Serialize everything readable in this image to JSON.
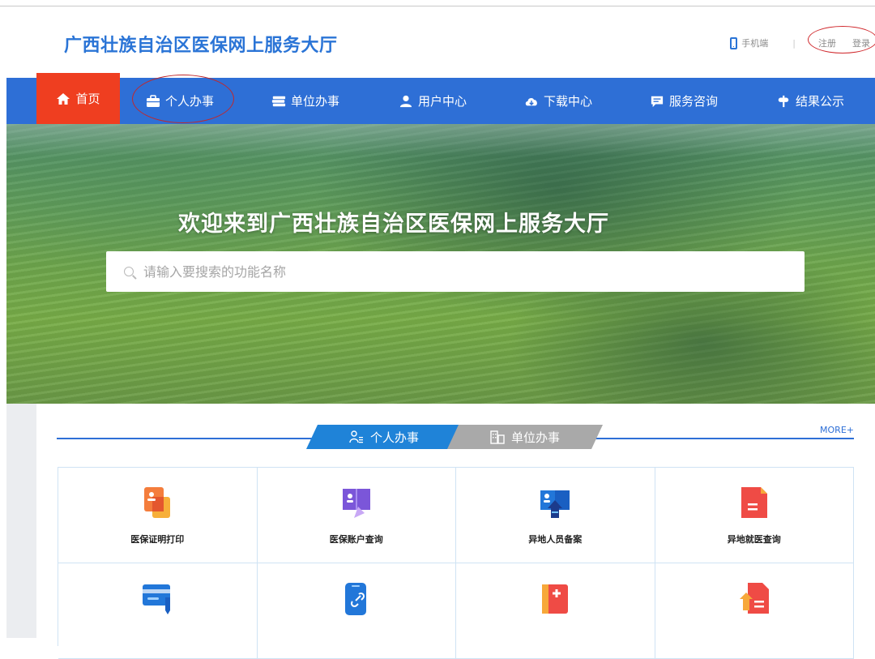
{
  "header": {
    "title": "广西壮族自治区医保网上服务大厅",
    "mobile_label": "手机端",
    "divider": "|",
    "register_label": "注册",
    "login_label": "登录"
  },
  "nav": {
    "items": [
      {
        "label": "首页",
        "icon": "home-icon"
      },
      {
        "label": "个人办事",
        "icon": "briefcase-icon"
      },
      {
        "label": "单位办事",
        "icon": "unit-icon"
      },
      {
        "label": "用户中心",
        "icon": "user-icon"
      },
      {
        "label": "下载中心",
        "icon": "cloud-download-icon"
      },
      {
        "label": "服务咨询",
        "icon": "chat-icon"
      },
      {
        "label": "结果公示",
        "icon": "signpost-icon"
      }
    ],
    "active_color": "#ef3e20",
    "bar_color": "#2e6fd6"
  },
  "hero": {
    "title": "欢迎来到广西壮族自治区医保网上服务大厅",
    "search_placeholder": "请输入要搜索的功能名称"
  },
  "services": {
    "tabs": [
      {
        "label": "个人办事",
        "active": true
      },
      {
        "label": "单位办事",
        "active": false
      }
    ],
    "more_label": "MORE+",
    "items": [
      {
        "label": "医保证明打印",
        "icon": "certificate-print-icon"
      },
      {
        "label": "医保账户查询",
        "icon": "account-query-icon"
      },
      {
        "label": "异地人员备案",
        "icon": "remote-registration-icon"
      },
      {
        "label": "异地就医查询",
        "icon": "remote-medical-query-icon"
      },
      {
        "label": "",
        "icon": "card-edit-icon"
      },
      {
        "label": "",
        "icon": "phone-link-icon"
      },
      {
        "label": "",
        "icon": "medical-book-icon"
      },
      {
        "label": "",
        "icon": "document-upload-icon"
      }
    ]
  }
}
